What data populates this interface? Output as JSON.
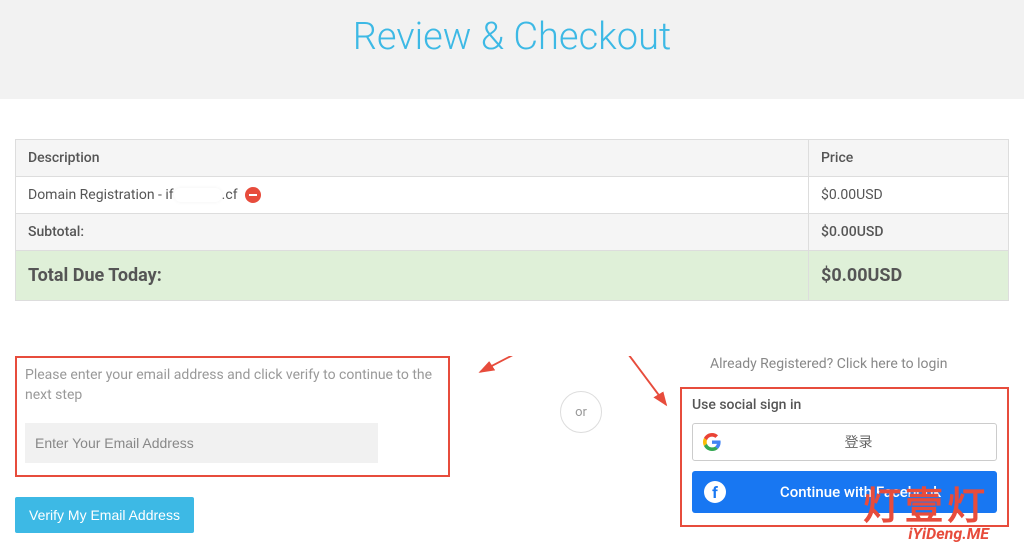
{
  "header": {
    "title": "Review & Checkout"
  },
  "table": {
    "columns": {
      "description": "Description",
      "price": "Price"
    },
    "items": [
      {
        "label_prefix": "Domain Registration - if",
        "label_suffix": ".cf",
        "price": "$0.00USD"
      }
    ],
    "subtotal": {
      "label": "Subtotal:",
      "value": "$0.00USD"
    },
    "total": {
      "label": "Total Due Today:",
      "value": "$0.00USD"
    }
  },
  "email_section": {
    "instructions": "Please enter your email address and click verify to continue to the next step",
    "placeholder": "Enter Your Email Address",
    "verify_button": "Verify My Email Address"
  },
  "divider": {
    "or": "or"
  },
  "right_section": {
    "already_registered": "Already Registered? Click here to login",
    "social_title": "Use social sign in",
    "google_label": "登录",
    "facebook_label": "Continue with Facebook"
  },
  "watermark": {
    "cn": "灯壹灯",
    "en": "iYiDeng.ME"
  }
}
